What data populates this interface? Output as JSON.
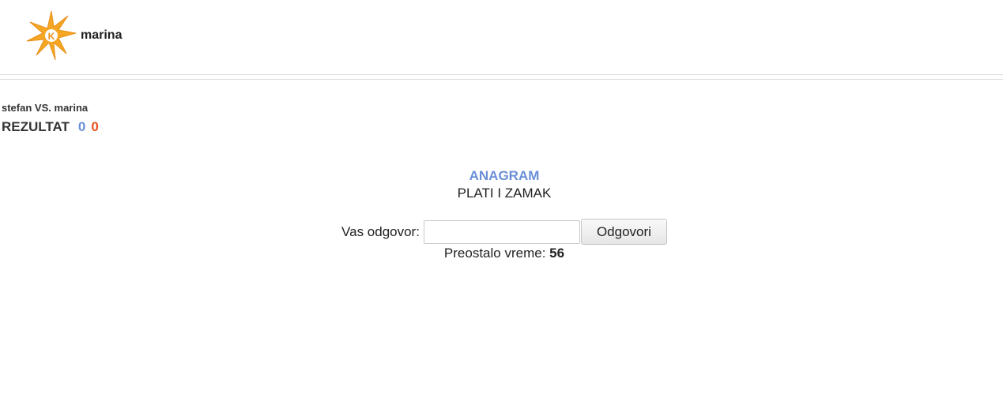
{
  "header": {
    "username": "marina",
    "logo_letter": "K",
    "logo_color": "#f5a623"
  },
  "match": {
    "player1": "stefan",
    "vs": "VS.",
    "player2": "marina",
    "score_label": "REZULTAT",
    "score_p1": "0",
    "score_p2": "0",
    "score_p1_color": "#6a8fd8",
    "score_p2_color": "#e8501e"
  },
  "game": {
    "title": "ANAGRAM",
    "word": "PLATI I ZAMAK",
    "answer_label": "Vas odgovor:",
    "answer_value": "",
    "submit_label": "Odgovori",
    "timer_label": "Preostalo vreme:",
    "timer_value": "56"
  }
}
